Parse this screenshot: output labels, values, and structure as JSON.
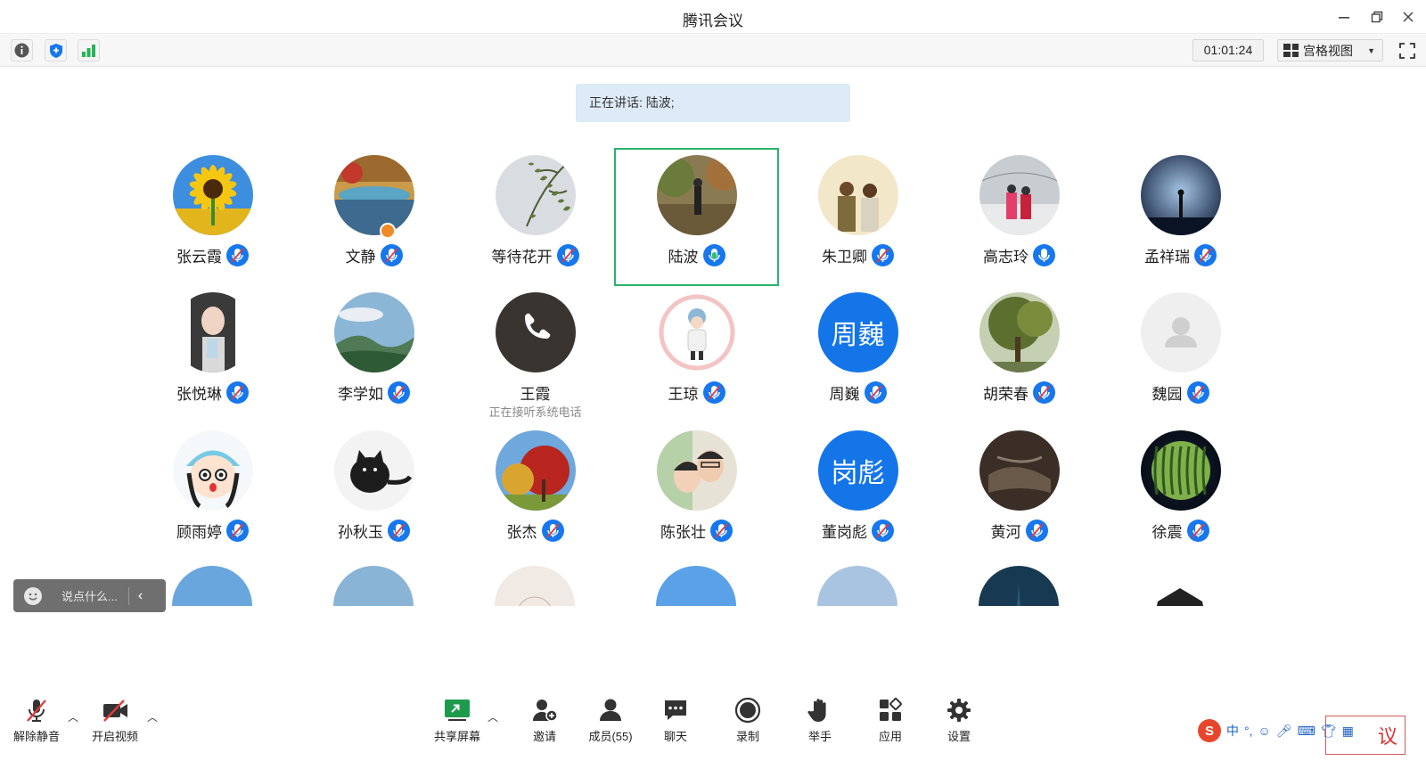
{
  "window": {
    "title": "腾讯会议"
  },
  "toolbar": {
    "timer": "01:01:24",
    "view_mode": "宫格视图"
  },
  "speaking": {
    "text": "正在讲话: 陆波;"
  },
  "participants": [
    {
      "name": "张云霞",
      "mic": "muted",
      "avatar": "sunflower"
    },
    {
      "name": "文静",
      "mic": "muted",
      "avatar": "lake"
    },
    {
      "name": "等待花开",
      "mic": "muted",
      "avatar": "branches"
    },
    {
      "name": "陆波",
      "mic": "speaking",
      "avatar": "woods"
    },
    {
      "name": "朱卫卿",
      "mic": "muted",
      "avatar": "couple"
    },
    {
      "name": "高志玲",
      "mic": "on",
      "avatar": "snow"
    },
    {
      "name": "孟祥瑞",
      "mic": "muted",
      "avatar": "night"
    },
    {
      "name": "张悦琳",
      "mic": "muted",
      "avatar": "portrait"
    },
    {
      "name": "李学如",
      "mic": "muted",
      "avatar": "mountain"
    },
    {
      "name": "王霞",
      "mic": "none",
      "avatar": "phone",
      "status": "正在接听系统电话"
    },
    {
      "name": "王琼",
      "mic": "muted",
      "avatar": "child"
    },
    {
      "name": "周巍",
      "mic": "muted",
      "avatar": "text",
      "initials": "周巍"
    },
    {
      "name": "胡荣春",
      "mic": "muted",
      "avatar": "tree"
    },
    {
      "name": "魏园",
      "mic": "muted",
      "avatar": "default"
    },
    {
      "name": "顾雨婷",
      "mic": "muted",
      "avatar": "cartoon"
    },
    {
      "name": "孙秋玉",
      "mic": "muted",
      "avatar": "cat"
    },
    {
      "name": "张杰",
      "mic": "muted",
      "avatar": "autumn"
    },
    {
      "name": "陈张壮",
      "mic": "muted",
      "avatar": "selfie"
    },
    {
      "name": "董岗彪",
      "mic": "muted",
      "avatar": "text",
      "initials": "岗彪"
    },
    {
      "name": "黄河",
      "mic": "muted",
      "avatar": "dark"
    },
    {
      "name": "徐震",
      "mic": "muted",
      "avatar": "watermelon"
    }
  ],
  "chat_hint": {
    "placeholder": "说点什么..."
  },
  "bottom": {
    "unmute": "解除静音",
    "video": "开启视频",
    "share": "共享屏幕",
    "invite": "邀请",
    "members": "成员(55)",
    "chat": "聊天",
    "record": "录制",
    "raise_hand": "举手",
    "apps": "应用",
    "settings": "设置"
  },
  "ime": {
    "lang": "中",
    "partial": "议"
  },
  "colors": {
    "accent": "#1677ee",
    "active_border": "#29b36b",
    "banner": "#ddeaf7"
  }
}
